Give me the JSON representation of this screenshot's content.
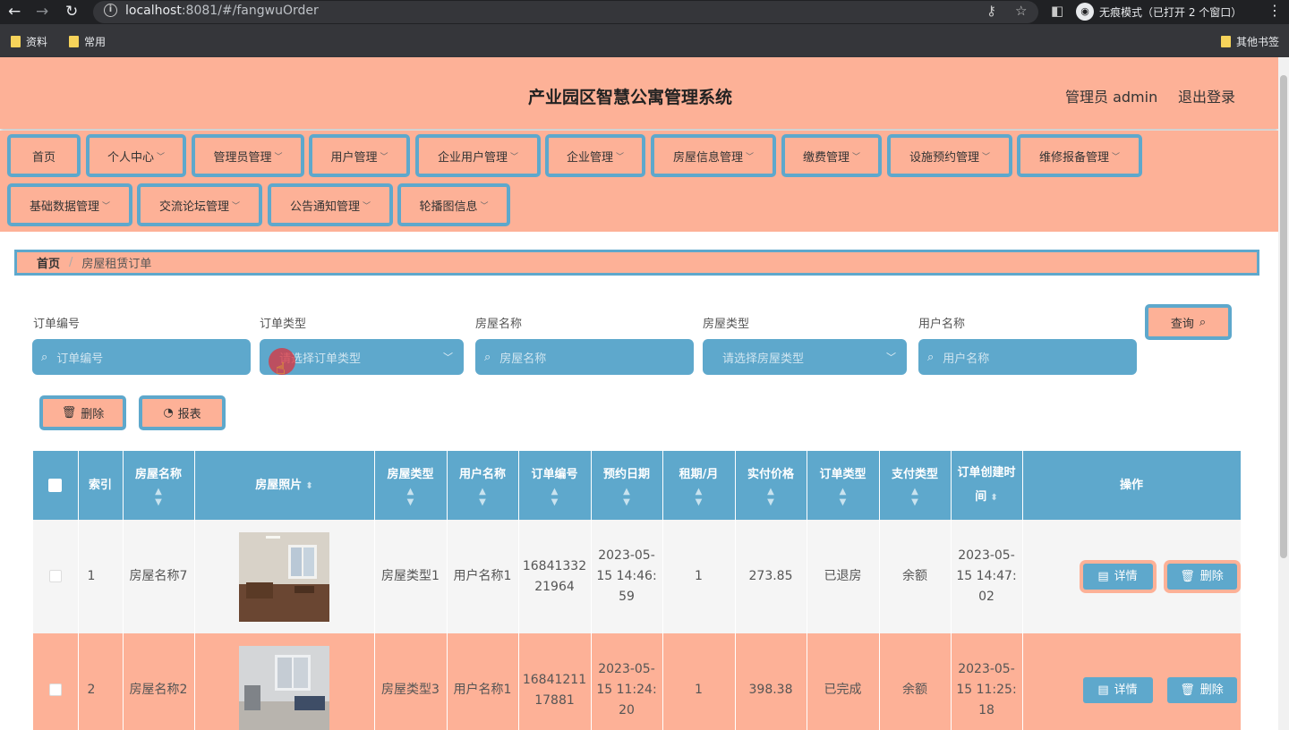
{
  "browser": {
    "url_host": "localhost",
    "url_rest": ":8081/#/fangwuOrder",
    "incognito_label": "无痕模式（已打开 2 个窗口）",
    "bookmarks": [
      "资料",
      "常用"
    ],
    "other_bookmarks": "其他书签"
  },
  "header": {
    "title": "产业园区智慧公寓管理系统",
    "admin_label": "管理员 admin",
    "logout": "退出登录"
  },
  "menu": [
    "首页",
    "个人中心",
    "管理员管理",
    "用户管理",
    "企业用户管理",
    "企业管理",
    "房屋信息管理",
    "缴费管理",
    "设施预约管理",
    "维修报备管理",
    "基础数据管理",
    "交流论坛管理",
    "公告通知管理",
    "轮播图信息"
  ],
  "breadcrumb": {
    "home": "首页",
    "current": "房屋租赁订单"
  },
  "filters": {
    "order_no": {
      "label": "订单编号",
      "placeholder": "订单编号"
    },
    "order_type": {
      "label": "订单类型",
      "placeholder": "请选择订单类型"
    },
    "house_name": {
      "label": "房屋名称",
      "placeholder": "房屋名称"
    },
    "house_type": {
      "label": "房屋类型",
      "placeholder": "请选择房屋类型"
    },
    "user_name": {
      "label": "用户名称",
      "placeholder": "用户名称"
    }
  },
  "buttons": {
    "query": "查询",
    "delete": "删除",
    "report": "报表"
  },
  "table": {
    "headers": {
      "index": "索引",
      "house_name": "房屋名称",
      "photo": "房屋照片",
      "house_type": "房屋类型",
      "user_name": "用户名称",
      "order_no": "订单编号",
      "reserve_date": "预约日期",
      "term": "租期/月",
      "price": "实付价格",
      "order_type": "订单类型",
      "pay_type": "支付类型",
      "create_time": "订单创建时间",
      "ops": "操作"
    },
    "rows": [
      {
        "index": "1",
        "house_name": "房屋名称7",
        "house_type": "房屋类型1",
        "user_name": "用户名称1",
        "order_no": "1684133221964",
        "reserve_date": "2023-05-15 14:46:59",
        "term": "1",
        "price": "273.85",
        "order_type": "已退房",
        "pay_type": "余额",
        "create_time": "2023-05-15 14:47:02",
        "detail": "详情",
        "delete": "删除"
      },
      {
        "index": "2",
        "house_name": "房屋名称2",
        "house_type": "房屋类型3",
        "user_name": "用户名称1",
        "order_no": "1684121117881",
        "reserve_date": "2023-05-15 11:24:20",
        "term": "1",
        "price": "398.38",
        "order_type": "已完成",
        "pay_type": "余额",
        "create_time": "2023-05-15 11:25:18",
        "detail": "详情",
        "delete": "删除"
      }
    ]
  },
  "colors": {
    "accent_blue": "#5ea8cc",
    "salmon": "#fdb197"
  }
}
